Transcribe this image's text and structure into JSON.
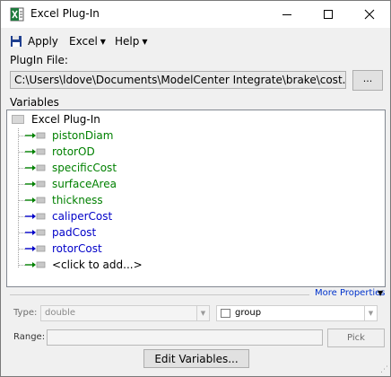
{
  "window": {
    "title": "Excel Plug-In"
  },
  "menu": {
    "apply_label": "Apply",
    "excel_label": "Excel",
    "help_label": "Help"
  },
  "plugin_file": {
    "label": "PlugIn File:",
    "path": "C:\\Users\\ldove\\Documents\\ModelCenter Integrate\\brake\\cost.xls",
    "browse_label": "..."
  },
  "variables": {
    "label": "Variables",
    "root": "Excel Plug-In",
    "items": [
      {
        "name": "pistonDiam",
        "direction": "input"
      },
      {
        "name": "rotorOD",
        "direction": "input"
      },
      {
        "name": "specificCost",
        "direction": "input"
      },
      {
        "name": "surfaceArea",
        "direction": "input"
      },
      {
        "name": "thickness",
        "direction": "input"
      },
      {
        "name": "caliperCost",
        "direction": "output"
      },
      {
        "name": "padCost",
        "direction": "output"
      },
      {
        "name": "rotorCost",
        "direction": "output"
      },
      {
        "name": "<click to add...>",
        "direction": "add"
      }
    ]
  },
  "more_properties": "More Properties",
  "type": {
    "label": "Type:",
    "value": "double"
  },
  "group": {
    "value": "group"
  },
  "range": {
    "label": "Range:",
    "value": "",
    "pick_label": "Pick"
  },
  "edit_variables_label": "Edit Variables...",
  "colors": {
    "input": "#008000",
    "output": "#0000c8",
    "link": "#0033cc"
  }
}
